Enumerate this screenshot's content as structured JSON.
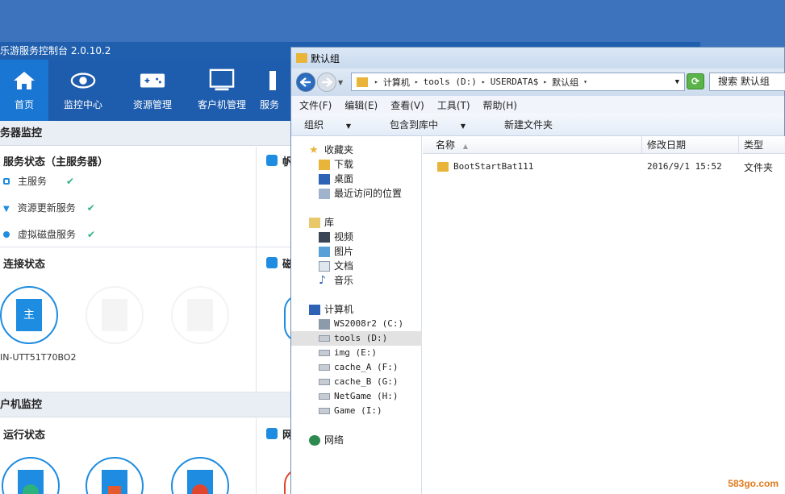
{
  "control_panel": {
    "title": "乐游服务控制台 2.0.10.2",
    "nav": [
      "首页",
      "监控中心",
      "资源管理",
      "客户机管理",
      "服务"
    ],
    "server_section": "务器监控",
    "service_status_title": "服务状态（主服务器）",
    "services": [
      "主服务",
      "资源更新服务",
      "虚拟磁盘服务"
    ],
    "connection_title": "连接状态",
    "server_label": "IN-UTT51T70BO2",
    "server_glyph": "主",
    "client_section": "户机监控",
    "run_status_title": "运行状态",
    "right_titles": [
      "帆",
      "磁",
      "网"
    ],
    "accent": "#1e5cad"
  },
  "explorer": {
    "title": "默认组",
    "address": [
      "计算机",
      "tools (D:)",
      "USERDATA$",
      "默认组"
    ],
    "search_placeholder": "搜索 默认组",
    "menu": [
      "文件(F)",
      "编辑(E)",
      "查看(V)",
      "工具(T)",
      "帮助(H)"
    ],
    "toolbar": [
      "组织",
      "包含到库中",
      "新建文件夹"
    ],
    "tree": {
      "favorites": "收藏夹",
      "fav_items": [
        "下载",
        "桌面",
        "最近访问的位置"
      ],
      "library": "库",
      "lib_items": [
        "视频",
        "图片",
        "文档",
        "音乐"
      ],
      "computer": "计算机",
      "drives": [
        "WS2008r2 (C:)",
        "tools (D:)",
        "img (E:)",
        "cache_A (F:)",
        "cache_B (G:)",
        "NetGame (H:)",
        "Game (I:)"
      ],
      "network": "网络"
    },
    "columns": [
      "名称",
      "修改日期",
      "类型"
    ],
    "files": [
      {
        "name": "BootStartBat111",
        "date": "2016/9/1 15:52",
        "type": "文件夹"
      }
    ]
  },
  "watermark": "583go.com"
}
